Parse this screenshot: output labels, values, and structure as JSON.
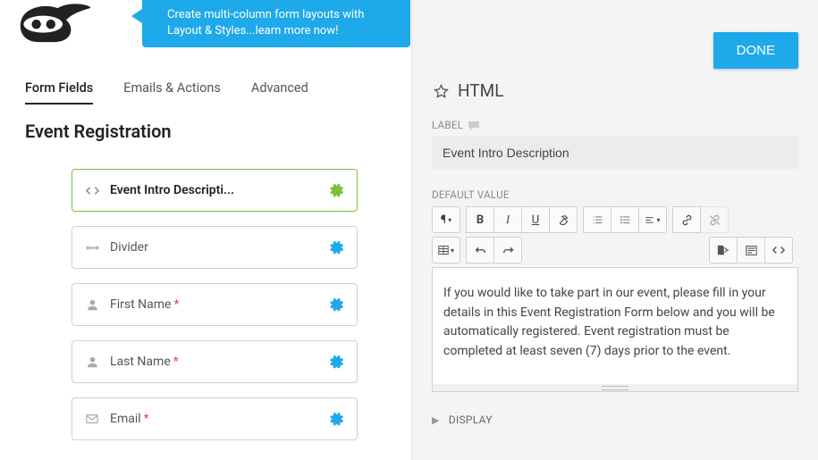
{
  "tip": "Create multi-column form layouts with Layout & Styles...learn more now!",
  "tabs": [
    "Form Fields",
    "Emails & Actions",
    "Advanced"
  ],
  "active_tab": 0,
  "form_title": "Event Registration",
  "fields": [
    {
      "icon": "code",
      "label": "Event Intro Descripti...",
      "required": false,
      "selected": true
    },
    {
      "icon": "arrows-h",
      "label": "Divider",
      "required": false,
      "selected": false
    },
    {
      "icon": "user",
      "label": "First Name",
      "required": true,
      "selected": false
    },
    {
      "icon": "user",
      "label": "Last Name",
      "required": true,
      "selected": false
    },
    {
      "icon": "envelope",
      "label": "Email",
      "required": true,
      "selected": false
    }
  ],
  "done_label": "DONE",
  "panel": {
    "title": "HTML",
    "label_section": "LABEL",
    "label_value": "Event Intro Description",
    "default_value_section": "DEFAULT VALUE",
    "editor_text": "If you would like to take part in our event, please fill in your details in this Event Registration Form below and you will be automatically registered. Event registration must be completed at least seven (7) days prior to the event.",
    "display_section": "DISPLAY"
  },
  "required_marker": "*"
}
